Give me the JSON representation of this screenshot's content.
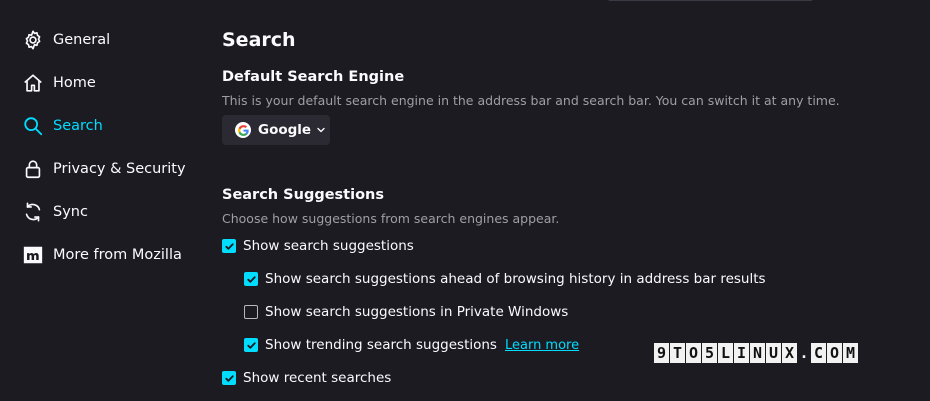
{
  "sidebar": {
    "items": [
      {
        "label": "General",
        "icon": "gear-icon"
      },
      {
        "label": "Home",
        "icon": "home-icon"
      },
      {
        "label": "Search",
        "icon": "search-icon",
        "selected": true
      },
      {
        "label": "Privacy & Security",
        "icon": "lock-icon"
      },
      {
        "label": "Sync",
        "icon": "sync-icon"
      },
      {
        "label": "More from Mozilla",
        "icon": "mozilla-icon"
      }
    ]
  },
  "main": {
    "title": "Search",
    "default_engine": {
      "heading": "Default Search Engine",
      "description": "This is your default search engine in the address bar and search bar. You can switch it at any time.",
      "selected": "Google"
    },
    "suggestions": {
      "heading": "Search Suggestions",
      "description": "Choose how suggestions from search engines appear.",
      "options": [
        {
          "label": "Show search suggestions",
          "checked": true
        },
        {
          "label": "Show search suggestions ahead of browsing history in address bar results",
          "checked": true
        },
        {
          "label": "Show search suggestions in Private Windows",
          "checked": false
        },
        {
          "label": "Show trending search suggestions",
          "checked": true,
          "link": "Learn more"
        },
        {
          "label": "Show recent searches",
          "checked": true
        }
      ]
    }
  },
  "watermark": {
    "text": "9TO5LINUX.COM"
  },
  "colors": {
    "background": "#1c1b22",
    "accent": "#00ddff",
    "text": "#fbfbfe",
    "muted_text": "#9f9ea6",
    "button_bg": "#2b2a33"
  }
}
